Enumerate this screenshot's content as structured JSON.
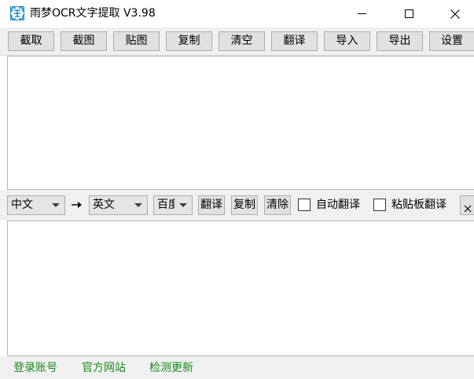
{
  "window": {
    "title": "雨梦OCR文字提取 V3.98",
    "icon": "ocr-app-icon",
    "controls": {
      "minimize_icon": "minimize-icon",
      "maximize_icon": "maximize-icon",
      "close_icon": "close-icon"
    }
  },
  "toolbar": {
    "buttons": [
      "截取",
      "截图",
      "贴图",
      "复制",
      "清空",
      "翻译",
      "导入",
      "导出",
      "设置"
    ]
  },
  "ocr_text": {
    "value": ""
  },
  "translation_bar": {
    "source_lang": "中文",
    "arrow_icon": "right-arrow-icon",
    "target_lang": "英文",
    "engine": "百度",
    "translate_label": "翻译",
    "copy_label": "复制",
    "clear_label": "清除",
    "auto_translate_label": "自动翻译",
    "auto_translate_checked": false,
    "clipboard_translate_label": "粘贴板翻译",
    "clipboard_translate_checked": false,
    "pin_close_icon": "close-icon"
  },
  "translated_text": {
    "value": ""
  },
  "footer": {
    "links": [
      "登录账号",
      "官方网站",
      "检测更新"
    ],
    "link_color": "#1a8a1a"
  }
}
